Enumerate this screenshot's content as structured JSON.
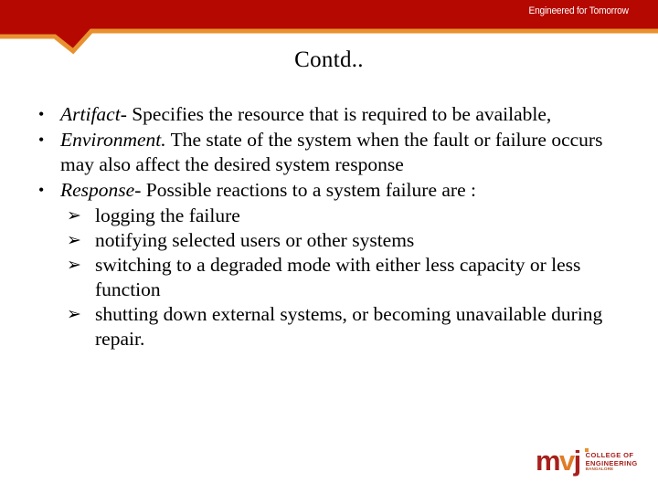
{
  "slide": {
    "title": "Contd..",
    "tagline": "Engineered for Tomorrow",
    "colors": {
      "banner_red": "#b50800",
      "banner_orange": "#e8922f",
      "text": "#000000",
      "background": "#ffffff",
      "logo_dark_red": "#a81f1b",
      "logo_orange": "#e07b28"
    }
  },
  "content": {
    "bullets": [
      {
        "marker": "•",
        "lead": "Artifact",
        "rest": "- Specifies the resource that is required to be available,"
      },
      {
        "marker": "•",
        "lead": "Environment.",
        "rest": " The state of the system when the fault or failure occurs may also affect the desired system response"
      },
      {
        "marker": "•",
        "lead": "Response",
        "rest": "- Possible reactions to a system failure are :"
      }
    ],
    "sub_bullets": [
      {
        "marker": "➢",
        "text": "logging the failure"
      },
      {
        "marker": "➢",
        "text": "notifying selected users or other systems"
      },
      {
        "marker": "➢",
        "text": "switching to a degraded mode with either less capacity or less function"
      },
      {
        "marker": "➢",
        "text": "shutting down external systems, or becoming unavailable during repair."
      }
    ]
  },
  "logo": {
    "wordmark_m": "m",
    "wordmark_v": "v",
    "wordmark_j": "j",
    "line1": "COLLEGE OF",
    "line2": "ENGINEERING",
    "line3": "BANGALORE"
  }
}
